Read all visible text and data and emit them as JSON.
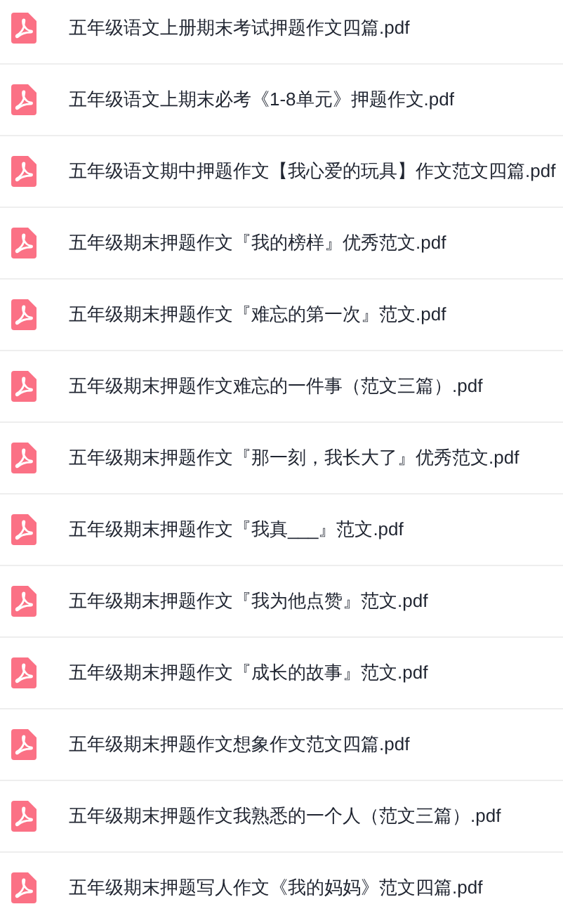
{
  "files": [
    {
      "name": "五年级语文上册期末考试押题作文四篇.pdf"
    },
    {
      "name": "五年级语文上期末必考《1-8单元》押题作文.pdf"
    },
    {
      "name": "五年级语文期中押题作文【我心爱的玩具】作文范文四篇.pdf"
    },
    {
      "name": "五年级期末押题作文『我的榜样』优秀范文.pdf"
    },
    {
      "name": "五年级期末押题作文『难忘的第一次』范文.pdf"
    },
    {
      "name": "五年级期末押题作文难忘的一件事（范文三篇）.pdf"
    },
    {
      "name": "五年级期末押题作文『那一刻，我长大了』优秀范文.pdf"
    },
    {
      "name": "五年级期末押题作文『我真___』范文.pdf"
    },
    {
      "name": "五年级期末押题作文『我为他点赞』范文.pdf"
    },
    {
      "name": "五年级期末押题作文『成长的故事』范文.pdf"
    },
    {
      "name": "五年级期末押题作文想象作文范文四篇.pdf"
    },
    {
      "name": "五年级期末押题作文我熟悉的一个人（范文三篇）.pdf"
    },
    {
      "name": "五年级期末押题写人作文《我的妈妈》范文四篇.pdf"
    }
  ]
}
